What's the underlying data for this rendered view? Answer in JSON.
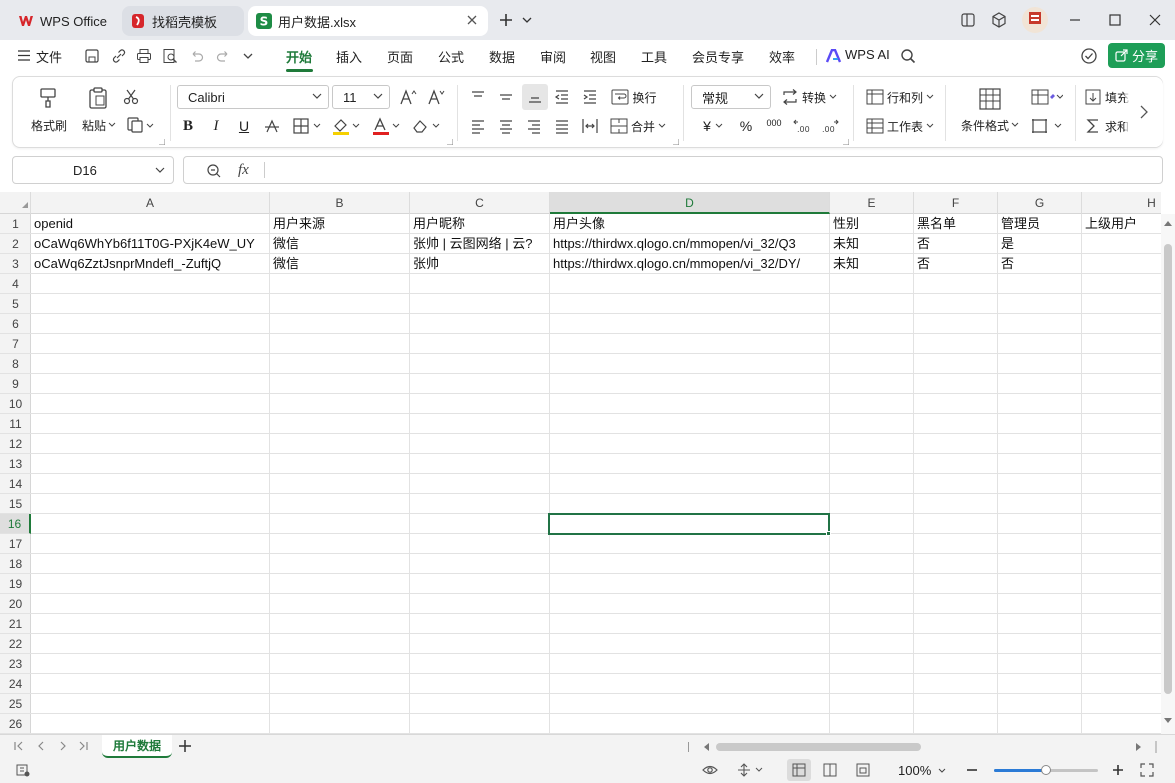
{
  "titlebar": {
    "tabs": [
      {
        "label": "WPS Office",
        "icon": "wps-logo-icon",
        "color": "#d6262b"
      },
      {
        "label": "找稻壳模板",
        "icon": "docer-icon",
        "color": "#d6262b"
      },
      {
        "label": "用户数据.xlsx",
        "icon": "spreadsheet-s-icon",
        "color": "#1e8c45"
      }
    ],
    "add_label": "+"
  },
  "menubar": {
    "file_label": "文件",
    "tabs": [
      "开始",
      "插入",
      "页面",
      "公式",
      "数据",
      "审阅",
      "视图",
      "工具",
      "会员专享",
      "效率"
    ],
    "ai_label": "WPS AI",
    "share_label": "分享"
  },
  "ribbon": {
    "format_painter": "格式刷",
    "paste": "粘贴",
    "font_name": "Calibri",
    "font_size": "11",
    "wrap": "换行",
    "merge": "合并",
    "number_format": "常规",
    "convert": "转换",
    "row_col": "行和列",
    "worksheet": "工作表",
    "cond_format": "条件格式",
    "fill": "填充",
    "sum": "求和",
    "currency_symbol": "¥",
    "percent_symbol": "%",
    "thousands_symbol": "000"
  },
  "formula_bar": {
    "name_box": "D16",
    "fx_label": "fx",
    "value": ""
  },
  "grid": {
    "columns": [
      "A",
      "B",
      "C",
      "D",
      "E",
      "F",
      "G",
      "H"
    ],
    "selected_column": "D",
    "rows": [
      "1",
      "2",
      "3",
      "4",
      "5",
      "6",
      "7",
      "8",
      "9",
      "10",
      "11",
      "12",
      "13",
      "14",
      "15",
      "16",
      "17",
      "18",
      "19",
      "20",
      "21",
      "22",
      "23",
      "24",
      "25",
      "26"
    ],
    "selected_row": "16",
    "data": [
      [
        "openid",
        "用户来源",
        "用户昵称",
        "用户头像",
        "性别",
        "黑名单",
        "管理员",
        "上级用户"
      ],
      [
        "oCaWq6WhYb6f11T0G-PXjK4eW_UY",
        "微信",
        "张帅 | 云图网络 | 云?",
        "https://thirdwx.qlogo.cn/mmopen/vi_32/Q3",
        "未知",
        "否",
        "是",
        ""
      ],
      [
        "oCaWq6ZztJsnprMndefI_-ZuftjQ",
        "微信",
        "张帅",
        "https://thirdwx.qlogo.cn/mmopen/vi_32/DY/",
        "未知",
        "否",
        "否",
        ""
      ]
    ]
  },
  "sheets": {
    "active": "用户数据",
    "add_label": "+"
  },
  "status": {
    "zoom": "100%",
    "zoom_level_percent": 50
  },
  "colors": {
    "accent": "#1f7a3a",
    "share_bg": "#1e9e57",
    "selection": "#217346"
  }
}
